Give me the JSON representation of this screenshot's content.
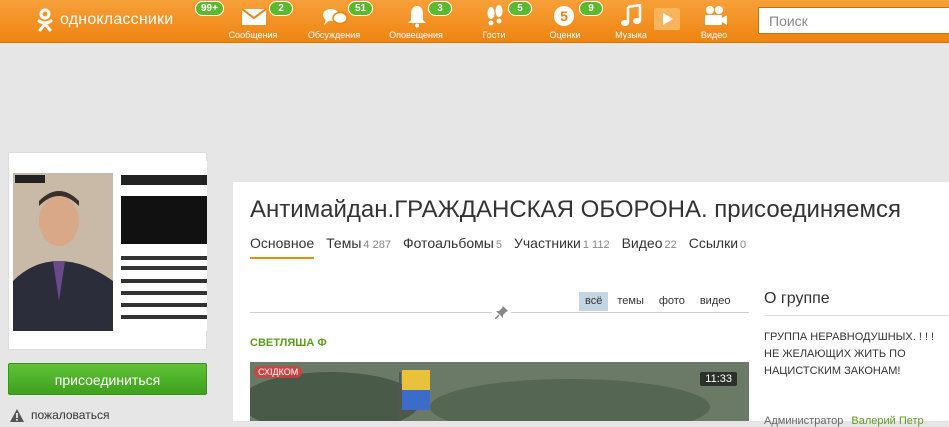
{
  "topbar": {
    "logo_text": "одноклассники",
    "logo_badge": "99+",
    "nav": [
      {
        "id": "messages",
        "label": "Сообщения",
        "badge": "2"
      },
      {
        "id": "discussions",
        "label": "Обсуждения",
        "badge": "51"
      },
      {
        "id": "notifications",
        "label": "Оповещения",
        "badge": "3"
      },
      {
        "id": "guests",
        "label": "Гости",
        "badge": "5"
      },
      {
        "id": "ratings",
        "label": "Оценки",
        "badge": "9"
      },
      {
        "id": "music",
        "label": "Музыка",
        "badge": ""
      },
      {
        "id": "video",
        "label": "Видео",
        "badge": ""
      }
    ],
    "search_placeholder": "Поиск"
  },
  "sidebar": {
    "avatar_alt": "group avatar",
    "join_label": "присоединиться",
    "complain_label": "пожаловаться"
  },
  "group": {
    "title": "Антимайдан.ГРАЖДАНСКАЯ ОБОРОНА. присоединяемся",
    "tabs": [
      {
        "label": "Основное",
        "count": ""
      },
      {
        "label": "Темы",
        "count": "4 287"
      },
      {
        "label": "Фотоальбомы",
        "count": "5"
      },
      {
        "label": "Участники",
        "count": "1 112"
      },
      {
        "label": "Видео",
        "count": "22"
      },
      {
        "label": "Ссылки",
        "count": "0"
      }
    ],
    "filters": [
      "всё",
      "темы",
      "фото",
      "видео"
    ],
    "post_author": "СВЕТЛЯША Ф",
    "video_logo": "СХІДКОМ",
    "video_duration": "11:33"
  },
  "about": {
    "title": "О группе",
    "text": "ГРУППА НЕРАВНОДУШНЫХ. ! ! ! НЕ ЖЕЛАЮЩИХ ЖИТЬ ПО НАЦИСТСКИМ ЗАКОНАМ!",
    "admin_label": "Администратор",
    "admin_name": "Валерий Петр"
  },
  "colors": {
    "accent": "#f08a10",
    "green": "#4aad25"
  }
}
